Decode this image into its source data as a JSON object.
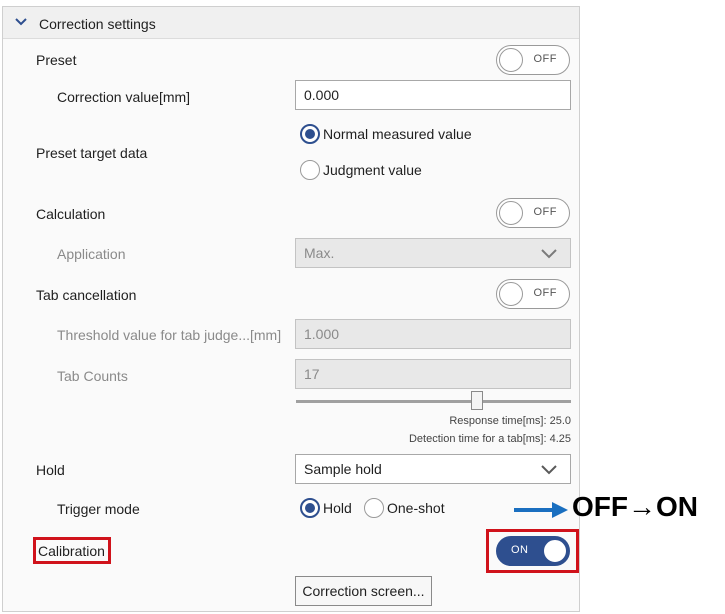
{
  "section": {
    "title": "Correction settings"
  },
  "preset": {
    "label": "Preset",
    "toggle": "OFF"
  },
  "correction_value": {
    "label": "Correction value[mm]",
    "value": "0.000"
  },
  "preset_target": {
    "label": "Preset target data",
    "options": [
      "Normal measured value",
      "Judgment value"
    ],
    "selected": "Normal measured value"
  },
  "calculation": {
    "label": "Calculation",
    "toggle": "OFF"
  },
  "application": {
    "label": "Application",
    "value": "Max."
  },
  "tab_cancellation": {
    "label": "Tab cancellation",
    "toggle": "OFF"
  },
  "threshold": {
    "label": "Threshold value for tab judge...[mm]",
    "value": "1.000"
  },
  "tab_counts": {
    "label": "Tab Counts",
    "value": "17"
  },
  "slider": {
    "response_time": "Response time[ms]: 25.0",
    "detection_time": "Detection time for a tab[ms]: 4.25"
  },
  "hold": {
    "label": "Hold",
    "value": "Sample hold"
  },
  "trigger_mode": {
    "label": "Trigger mode",
    "options": [
      "Hold",
      "One-shot"
    ],
    "selected": "Hold"
  },
  "calibration": {
    "label": "Calibration",
    "toggle": "ON"
  },
  "correction_screen_button": "Correction screen...",
  "annotation": {
    "text": "OFF→ON"
  },
  "colors": {
    "accent": "#2e4f8f",
    "highlight": "#d0121b",
    "arrow": "#1a6fc0"
  }
}
